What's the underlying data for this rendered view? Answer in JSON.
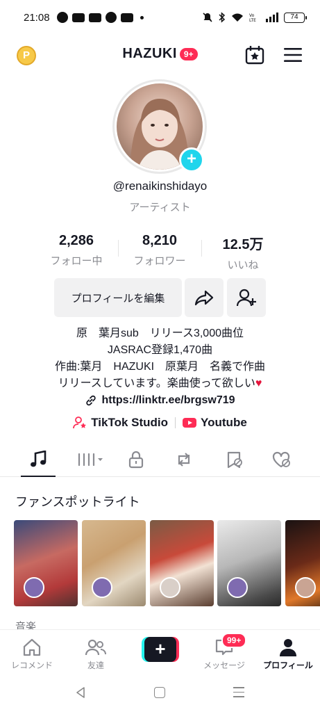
{
  "status_bar": {
    "time": "21:08",
    "battery": "74"
  },
  "header": {
    "title": "HAZUKI",
    "title_badge": "9+",
    "coin_symbol": "P"
  },
  "profile": {
    "username": "@renaikinshidayo",
    "category": "アーティスト",
    "stats": [
      {
        "value": "2,286",
        "label": "フォロー中"
      },
      {
        "value": "8,210",
        "label": "フォロワー"
      },
      {
        "value": "12.5万",
        "label": "いいね"
      }
    ],
    "edit_button": "プロフィールを編集",
    "bio_lines": [
      "原　葉月sub　リリース3,000曲位",
      "JASRAC登録1,470曲",
      "作曲:葉月　HAZUKI　原葉月　名義で作曲",
      "リリースしています。楽曲使って欲しい"
    ],
    "bio_heart": "♥",
    "link": "https://linktr.ee/brgsw719",
    "chips": [
      "TikTok Studio",
      "Youtube"
    ]
  },
  "tabs": [
    "music-icon",
    "playlist-icon",
    "lock-icon",
    "repost-icon",
    "favorites-icon",
    "liked-icon"
  ],
  "fan_spotlight": {
    "title": "ファンスポットライト"
  },
  "section2_title": "音楽",
  "bottom_nav": {
    "items": [
      "レコメンド",
      "友達",
      "",
      "メッセージ",
      "プロフィール"
    ],
    "message_badge": "99+",
    "create_symbol": "+"
  },
  "colors": {
    "accent": "#fe2c55",
    "cyan": "#20d5ec",
    "text": "#161823",
    "muted": "#8a8b91"
  }
}
